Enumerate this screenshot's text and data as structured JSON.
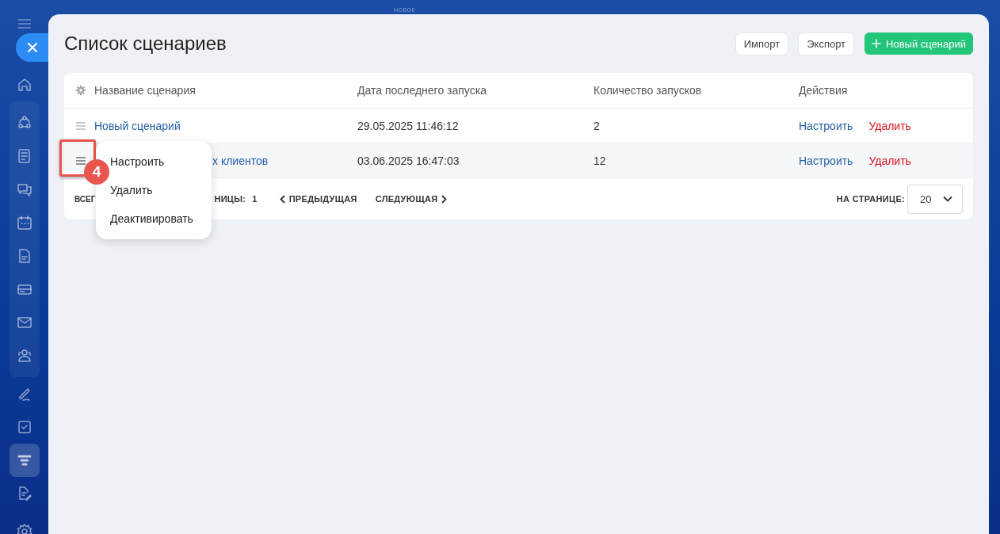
{
  "background_label": "НОВОЕ",
  "sidebar": {
    "sections": [
      {
        "boxed": false,
        "items": [
          {
            "selected": false
          }
        ]
      },
      {
        "boxed": true,
        "items": [
          {
            "selected": false
          },
          {
            "selected": false
          },
          {
            "selected": false
          },
          {
            "selected": false
          },
          {
            "selected": false
          },
          {
            "selected": false
          },
          {
            "selected": false
          },
          {
            "selected": false
          }
        ]
      },
      {
        "boxed": false,
        "items": [
          {
            "selected": false
          },
          {
            "selected": false
          },
          {
            "selected": true
          },
          {
            "selected": false
          }
        ]
      }
    ]
  },
  "page": {
    "title": "Список сценариев",
    "buttons": [
      {
        "label": "Импорт",
        "kind": "plain"
      },
      {
        "label": "Экспорт",
        "kind": "plain"
      },
      {
        "label": "Новый сценарий",
        "kind": "primary"
      }
    ]
  },
  "table": {
    "columns": [
      "Название сценария",
      "Дата последнего запуска",
      "Количество запусков",
      "Действия"
    ],
    "rows": [
      {
        "name": "Новый сценарий",
        "date": "29.05.2025 11:46:12",
        "count": "2",
        "actions": [
          "Настроить",
          "Удалить"
        ],
        "menu_open": false
      },
      {
        "name": "х клиентов",
        "date": "03.06.2025 16:47:03",
        "count": "12",
        "actions": [
          "Настроить",
          "Удалить"
        ],
        "menu_open": true
      }
    ],
    "menu": {
      "items": [
        "Настроить",
        "Удалить",
        "Деактивировать"
      ],
      "badge": "4"
    },
    "footer": {
      "total_label": "ВСЕГ",
      "pages_label": "НИЦЫ:",
      "pages_value": "1",
      "prev": "ПРЕДЫДУЩАЯ",
      "next": "СЛЕДУЮЩАЯ",
      "per_page_label": "НА СТРАНИЦЕ:",
      "per_page_value": "20"
    }
  }
}
